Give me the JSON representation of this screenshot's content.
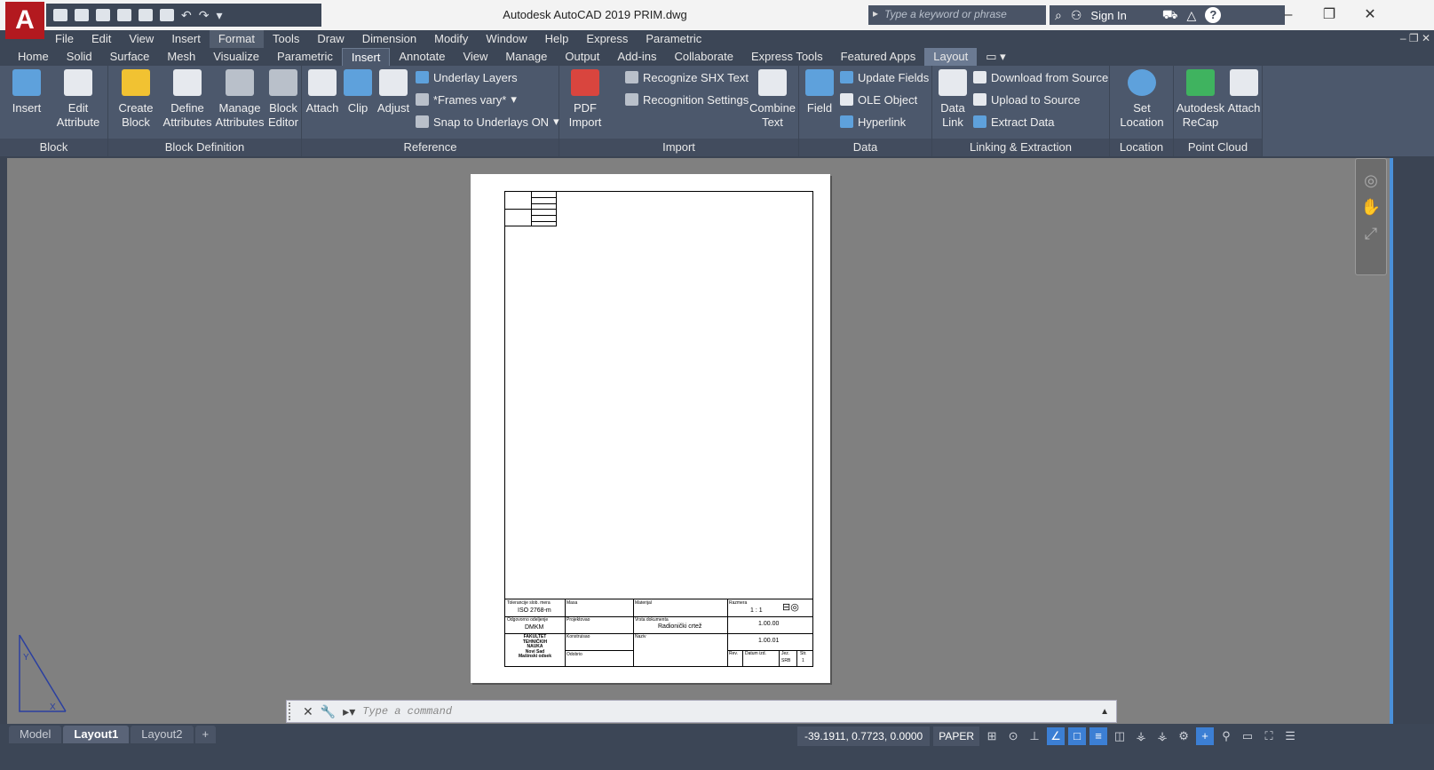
{
  "app": {
    "logo_letter": "A",
    "window_title": "Autodesk AutoCAD 2019    PRIM.dwg",
    "search_placeholder": "Type a keyword or phrase",
    "sign_in": "Sign In",
    "help": "?"
  },
  "quick_access": {
    "icons": [
      "new-icon",
      "open-icon",
      "save-icon",
      "save-as-icon",
      "web-icon",
      "plot-icon",
      "undo-icon",
      "redo-icon"
    ]
  },
  "menubar": {
    "items": [
      "File",
      "Edit",
      "View",
      "Insert",
      "Format",
      "Tools",
      "Draw",
      "Dimension",
      "Modify",
      "Window",
      "Help",
      "Express",
      "Parametric"
    ],
    "active": "Format"
  },
  "ribbon_tabs": {
    "items": [
      "Home",
      "Solid",
      "Surface",
      "Mesh",
      "Visualize",
      "Parametric",
      "Insert",
      "Annotate",
      "View",
      "Manage",
      "Output",
      "Add-ins",
      "Collaborate",
      "Express Tools",
      "Featured Apps",
      "Layout"
    ],
    "active": "Insert"
  },
  "ribbon": {
    "block": {
      "title": "Block",
      "insert": "Insert",
      "edit_attribute_1": "Edit",
      "edit_attribute_2": "Attribute"
    },
    "block_definition": {
      "title": "Block Definition",
      "create_1": "Create",
      "create_2": "Block",
      "define_1": "Define",
      "define_2": "Attributes",
      "manage_1": "Manage",
      "manage_2": "Attributes",
      "editor_1": "Block",
      "editor_2": "Editor"
    },
    "reference": {
      "title": "Reference",
      "attach": "Attach",
      "clip": "Clip",
      "adjust": "Adjust",
      "underlay_layers": "Underlay Layers",
      "frames": "*Frames vary*",
      "snap": "Snap to Underlays ON"
    },
    "import": {
      "title": "Import",
      "pdf_1": "PDF",
      "pdf_2": "Import",
      "recognize": "Recognize SHX Text",
      "recognition_settings": "Recognition Settings",
      "combine_1": "Combine",
      "combine_2": "Text"
    },
    "data": {
      "title": "Data",
      "field": "Field",
      "update_fields": "Update Fields",
      "ole_object": "OLE Object",
      "hyperlink": "Hyperlink"
    },
    "linking": {
      "title": "Linking & Extraction",
      "data_link_1": "Data",
      "data_link_2": "Link",
      "download": "Download from Source",
      "upload": "Upload to Source",
      "extract": "Extract  Data"
    },
    "location": {
      "title": "Location",
      "set_1": "Set",
      "set_2": "Location"
    },
    "point_cloud": {
      "title": "Point Cloud",
      "recap_1": "Autodesk",
      "recap_2": "ReCap",
      "attach": "Attach"
    }
  },
  "title_block": {
    "tolerance_label": "Tolerancije slob. mera",
    "tolerance_value": "ISO 2768-m",
    "mass_label": "Masa",
    "material_label": "Materijal",
    "scale_label": "Razmera",
    "scale_value": "1 : 1",
    "department_label": "Odgovorno odeljenje",
    "department_value": "DMKM",
    "designed_label": "Projektovao",
    "doc_type_label": "Vrsta dokumenta",
    "doc_type_value": "Radionički crtež",
    "drawing_no_1": "1.00.00",
    "faculty_1": "FAKULTET",
    "faculty_2": "TEHNIČKIH",
    "faculty_3": "NAUKA",
    "faculty_4": "Novi Sad",
    "faculty_5": "Mašinski odsek",
    "drafted_label": "Konstruisao",
    "name_label": "Naziv",
    "drawing_no_2": "1.00.01",
    "approved_label": "Odobrio",
    "rev_label": "Rev.",
    "date_label": "Datum izd.",
    "lang_label": "Jez.",
    "lang_value": "SRB",
    "sheet_label": "Str.",
    "sheet_value": "1"
  },
  "command_line": {
    "placeholder": "Type a command"
  },
  "statusbar": {
    "layout_tabs": [
      "Model",
      "Layout1",
      "Layout2"
    ],
    "active_tab": "Layout1",
    "plus": "+",
    "coordinates": "-39.1911, 0.7723, 0.0000",
    "space": "PAPER"
  },
  "colors": {
    "ui_dark": "#3c4656",
    "ribbon": "#4c586c",
    "canvas": "#808080",
    "accent": "#3c7fd4",
    "logo": "#b3191f"
  }
}
